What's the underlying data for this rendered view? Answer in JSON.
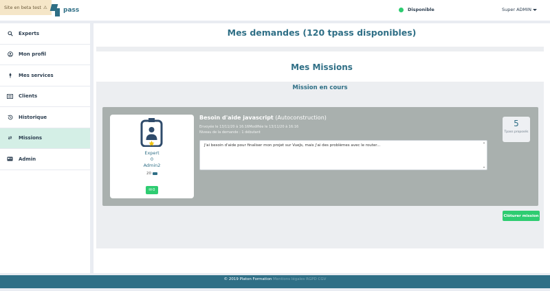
{
  "topbar": {
    "beta_text": "Site en beta test",
    "logo_text": "pass",
    "status_label": "Disponible",
    "status_color": "#2ecc71",
    "user_menu_label": "Super ADMIN"
  },
  "sidebar": {
    "items": [
      {
        "label": "Experts",
        "icon": "search-icon"
      },
      {
        "label": "Mon profil",
        "icon": "user-circle-icon"
      },
      {
        "label": "Mes services",
        "icon": "pin-icon"
      },
      {
        "label": "Clients",
        "icon": "id-card-icon"
      },
      {
        "label": "Historique",
        "icon": "history-icon"
      },
      {
        "label": "Missions",
        "icon": "exchange-icon",
        "active": true
      },
      {
        "label": "Admin",
        "icon": "admin-card-icon"
      }
    ]
  },
  "main": {
    "page_title": "Mes demandes (120 tpass disponibles)",
    "section_title": "Mes Missions",
    "panel_title": "Mission en cours",
    "mission": {
      "expert_role": "Expert",
      "expert_number": "0",
      "expert_name": "Admin2",
      "credits": "20",
      "chat_count": "0",
      "request_title": "Besoin d'aide javascript",
      "request_category": "(Autoconstruction)",
      "sent_line": "Envoyée le 13/11/20 à 16:16Modifiée le 13/11/20 à 16:16",
      "level_line": "Niveau de la demande : 1 débutant",
      "message": "J'ai besoin d'aide pour finaliser mon projet sur VueJs, mais j'ai des problèmes avec le router...",
      "tpass_count": "5",
      "tpass_label": "Tpass proposés"
    },
    "close_button_label": "Clôturer mission"
  },
  "footer": {
    "copyright": "© 2019 Platon Formation",
    "links": "Mentions légales RGPD CGV"
  },
  "colors": {
    "accent": "#2f6f86",
    "active_nav": "#d4efe6",
    "success": "#2ecc71",
    "mission_bg": "#a9b0ae"
  }
}
